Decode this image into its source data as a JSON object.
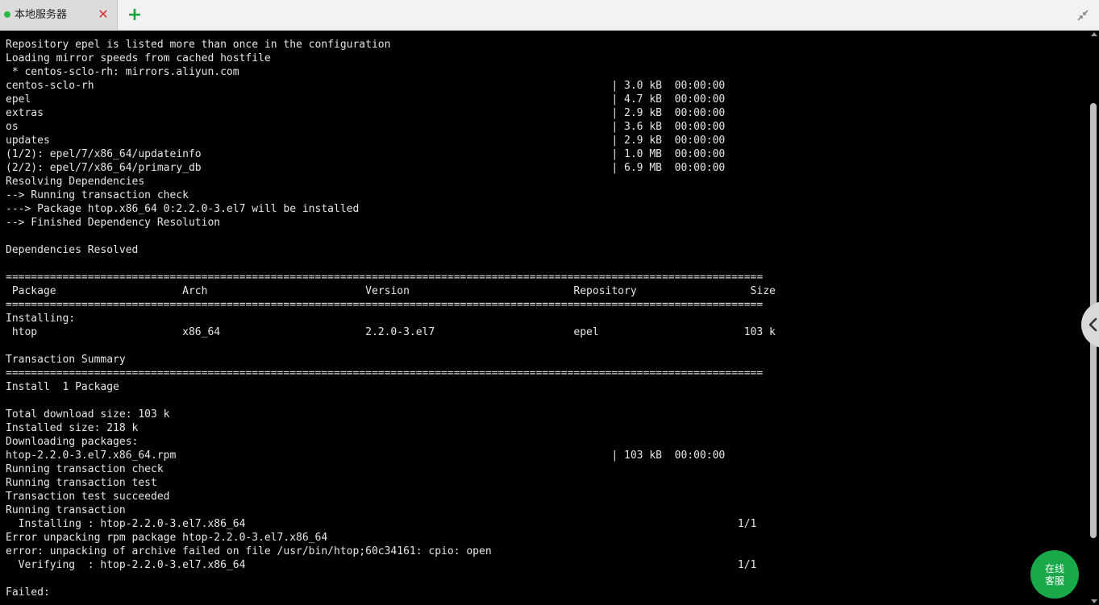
{
  "tabs": {
    "items": [
      {
        "label": "本地服务器",
        "status_color": "#2db84a",
        "active": true
      }
    ],
    "close_glyph": "✕",
    "add_glyph": "+"
  },
  "icons": {
    "tab_status": "status-dot-icon",
    "tab_close": "close-icon",
    "tab_add": "plus-icon",
    "collapse": "collapse-arrows-icon",
    "side_toggle": "chevron-left-icon"
  },
  "support_button": {
    "line1": "在线",
    "line2": "客服",
    "color": "#1aa94a"
  },
  "terminal": {
    "lines": [
      "Repository epel is listed more than once in the configuration",
      "Loading mirror speeds from cached hostfile",
      " * centos-sclo-rh: mirrors.aliyun.com",
      "centos-sclo-rh                                                                                  | 3.0 kB  00:00:00",
      "epel                                                                                            | 4.7 kB  00:00:00",
      "extras                                                                                          | 2.9 kB  00:00:00",
      "os                                                                                              | 3.6 kB  00:00:00",
      "updates                                                                                         | 2.9 kB  00:00:00",
      "(1/2): epel/7/x86_64/updateinfo                                                                 | 1.0 MB  00:00:00",
      "(2/2): epel/7/x86_64/primary_db                                                                 | 6.9 MB  00:00:00",
      "Resolving Dependencies",
      "--> Running transaction check",
      "---> Package htop.x86_64 0:2.2.0-3.el7 will be installed",
      "--> Finished Dependency Resolution",
      "",
      "Dependencies Resolved",
      "",
      "========================================================================================================================",
      " Package                    Arch                         Version                          Repository                  Size",
      "========================================================================================================================",
      "Installing:",
      " htop                       x86_64                       2.2.0-3.el7                      epel                       103 k",
      "",
      "Transaction Summary",
      "========================================================================================================================",
      "Install  1 Package",
      "",
      "Total download size: 103 k",
      "Installed size: 218 k",
      "Downloading packages:",
      "htop-2.2.0-3.el7.x86_64.rpm                                                                     | 103 kB  00:00:00",
      "Running transaction check",
      "Running transaction test",
      "Transaction test succeeded",
      "Running transaction",
      "  Installing : htop-2.2.0-3.el7.x86_64                                                                              1/1",
      "Error unpacking rpm package htop-2.2.0-3.el7.x86_64",
      "error: unpacking of archive failed on file /usr/bin/htop;60c34161: cpio: open",
      "  Verifying  : htop-2.2.0-3.el7.x86_64                                                                              1/1",
      "",
      "Failed:"
    ]
  }
}
